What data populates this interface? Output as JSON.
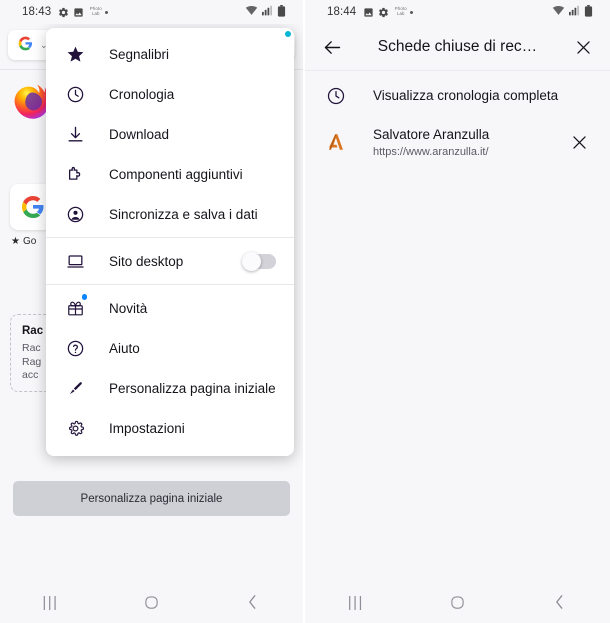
{
  "left": {
    "statusbar": {
      "time": "18:43",
      "icons": [
        "gear-icon",
        "image-icon"
      ],
      "app_badge": "Photo Lab",
      "right_icons": [
        "wifi-icon",
        "signal-icon",
        "battery-icon"
      ]
    },
    "home": {
      "search_logo": "G",
      "search_chevron": "⌄",
      "tile_label": "Go",
      "tile_logo": "G",
      "card_title": "Rac",
      "card_body": "Rac\nRag\nacc",
      "bottom_button": "Personalizza pagina iniziale"
    },
    "menu": {
      "items": [
        {
          "label": "Segnalibri",
          "icon": "star-icon",
          "badge": false,
          "toggle": null,
          "divider_after": false
        },
        {
          "label": "Cronologia",
          "icon": "clock-icon",
          "badge": false,
          "toggle": null,
          "divider_after": false
        },
        {
          "label": "Download",
          "icon": "download-icon",
          "badge": false,
          "toggle": null,
          "divider_after": false
        },
        {
          "label": "Componenti aggiuntivi",
          "icon": "puzzle-icon",
          "badge": false,
          "toggle": null,
          "divider_after": false
        },
        {
          "label": "Sincronizza e salva i dati",
          "icon": "account-icon",
          "badge": false,
          "toggle": null,
          "divider_after": true
        },
        {
          "label": "Sito desktop",
          "icon": "desktop-icon",
          "badge": false,
          "toggle": "off",
          "divider_after": true
        },
        {
          "label": "Novità",
          "icon": "gift-icon",
          "badge": true,
          "toggle": null,
          "divider_after": false
        },
        {
          "label": "Aiuto",
          "icon": "help-icon",
          "badge": false,
          "toggle": null,
          "divider_after": false
        },
        {
          "label": "Personalizza pagina iniziale",
          "icon": "brush-icon",
          "badge": false,
          "toggle": null,
          "divider_after": false
        },
        {
          "label": "Impostazioni",
          "icon": "gear-icon",
          "badge": false,
          "toggle": null,
          "divider_after": false
        }
      ],
      "notification_dot_color": "#00b7d6"
    },
    "navbar": {
      "recents": "|||",
      "home": "O",
      "back": "‹"
    }
  },
  "right": {
    "statusbar": {
      "time": "18:44",
      "icons": [
        "image-icon",
        "gear-icon"
      ],
      "app_badge": "Photo Lab",
      "right_icons": [
        "wifi-icon",
        "signal-icon",
        "battery-icon"
      ]
    },
    "header": {
      "back_icon": "arrow-left-icon",
      "title": "Schede chiuse di rec…",
      "close_icon": "close-icon"
    },
    "rows": [
      {
        "type": "action",
        "icon": "clock-icon",
        "title": "Visualizza cronologia completa"
      },
      {
        "type": "tab",
        "icon": "aranzulla-favicon",
        "favicon_letter": "A",
        "favicon_color": "#d9761f",
        "title": "Salvatore Aranzulla",
        "url": "https://www.aranzulla.it/",
        "close_icon": "close-icon"
      }
    ],
    "navbar": {
      "recents": "|||",
      "home": "O",
      "back": "‹"
    }
  }
}
